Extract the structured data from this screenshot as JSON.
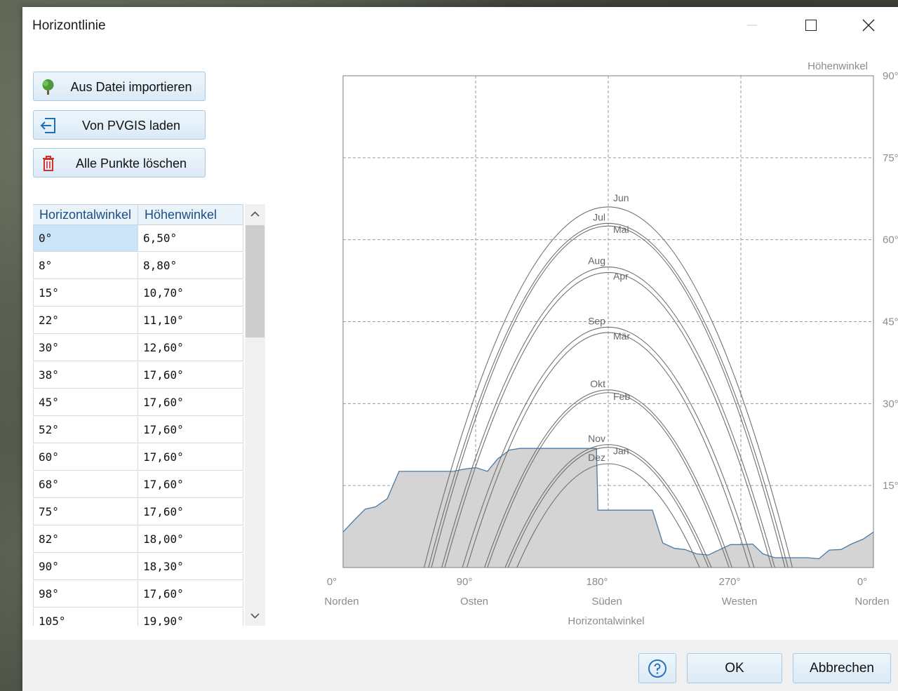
{
  "window": {
    "title": "Horizontlinie"
  },
  "actions": {
    "import_label": "Aus Datei importieren",
    "pvgis_label": "Von PVGIS laden",
    "delete_label": "Alle Punkte löschen"
  },
  "table": {
    "headers": [
      "Horizontalwinkel",
      "Höhenwinkel"
    ],
    "rows": [
      [
        "0°",
        "6,50°"
      ],
      [
        "8°",
        "8,80°"
      ],
      [
        "15°",
        "10,70°"
      ],
      [
        "22°",
        "11,10°"
      ],
      [
        "30°",
        "12,60°"
      ],
      [
        "38°",
        "17,60°"
      ],
      [
        "45°",
        "17,60°"
      ],
      [
        "52°",
        "17,60°"
      ],
      [
        "60°",
        "17,60°"
      ],
      [
        "68°",
        "17,60°"
      ],
      [
        "75°",
        "17,60°"
      ],
      [
        "82°",
        "18,00°"
      ],
      [
        "90°",
        "18,30°"
      ],
      [
        "98°",
        "17,60°"
      ],
      [
        "105°",
        "19,90°"
      ]
    ],
    "selected_row": 0
  },
  "chart_data": {
    "type": "area",
    "xlabel": "Horizontalwinkel",
    "ylabel": "Höhenwinkel",
    "xlim": [
      0,
      360
    ],
    "ylim": [
      0,
      90
    ],
    "grid": true,
    "x_ticks": [
      {
        "value": 0,
        "label": "0°",
        "sub": "Norden"
      },
      {
        "value": 90,
        "label": "90°",
        "sub": "Osten"
      },
      {
        "value": 180,
        "label": "180°",
        "sub": "Süden"
      },
      {
        "value": 270,
        "label": "270°",
        "sub": "Westen"
      },
      {
        "value": 360,
        "label": "0°",
        "sub": "Norden"
      }
    ],
    "y_ticks": [
      {
        "value": 15,
        "label": "15°"
      },
      {
        "value": 30,
        "label": "30°"
      },
      {
        "value": 45,
        "label": "45°"
      },
      {
        "value": 60,
        "label": "60°"
      },
      {
        "value": 75,
        "label": "75°"
      },
      {
        "value": 90,
        "label": "90°"
      }
    ],
    "horizon": {
      "x": [
        0,
        8,
        15,
        22,
        30,
        38,
        45,
        52,
        60,
        68,
        75,
        82,
        90,
        98,
        105,
        113,
        120,
        128,
        135,
        143,
        150,
        158,
        165,
        172,
        173,
        180,
        188,
        195,
        203,
        210,
        217,
        225,
        232,
        240,
        248,
        255,
        263,
        270,
        278,
        285,
        293,
        300,
        308,
        315,
        323,
        330,
        338,
        345,
        353,
        360
      ],
      "y": [
        6.5,
        8.8,
        10.7,
        11.1,
        12.6,
        17.6,
        17.6,
        17.6,
        17.6,
        17.6,
        17.6,
        18.0,
        18.3,
        17.6,
        19.9,
        21.5,
        21.8,
        21.8,
        21.8,
        21.8,
        21.8,
        21.8,
        21.8,
        21.8,
        10.5,
        10.5,
        10.5,
        10.5,
        10.5,
        10.5,
        4.5,
        3.5,
        3.3,
        2.5,
        2.3,
        3.2,
        4.2,
        4.2,
        4.3,
        2.5,
        1.8,
        1.8,
        1.8,
        1.8,
        1.6,
        3.2,
        3.3,
        4.3,
        5.2,
        6.5
      ]
    },
    "sun_paths": [
      {
        "label": "Jun",
        "elevation": 66,
        "azimuth_range": [
          55,
          305
        ]
      },
      {
        "label": "Jul",
        "elevation": 63,
        "azimuth_range": [
          58,
          302
        ]
      },
      {
        "label": "Mai",
        "elevation": 62.5,
        "azimuth_range": [
          60,
          300
        ]
      },
      {
        "label": "Aug",
        "elevation": 55,
        "azimuth_range": [
          67,
          293
        ]
      },
      {
        "label": "Apr",
        "elevation": 54,
        "azimuth_range": [
          69,
          291
        ]
      },
      {
        "label": "Sep",
        "elevation": 44,
        "azimuth_range": [
          81,
          279
        ]
      },
      {
        "label": "Mär",
        "elevation": 43,
        "azimuth_range": [
          84,
          276
        ]
      },
      {
        "label": "Okt",
        "elevation": 32.5,
        "azimuth_range": [
          96,
          264
        ]
      },
      {
        "label": "Feb",
        "elevation": 32,
        "azimuth_range": [
          98,
          262
        ]
      },
      {
        "label": "Nov",
        "elevation": 22.5,
        "azimuth_range": [
          110,
          250
        ]
      },
      {
        "label": "Jan",
        "elevation": 22,
        "azimuth_range": [
          112,
          248
        ]
      },
      {
        "label": "Dez",
        "elevation": 19,
        "azimuth_range": [
          118,
          242
        ]
      }
    ],
    "colors": {
      "horizon_fill": "#d4d4d4",
      "horizon_line": "#4a7aa8",
      "grid": "#9a9a9a",
      "paths": "#6e6e6e"
    }
  },
  "footer": {
    "ok_label": "OK",
    "cancel_label": "Abbrechen"
  }
}
